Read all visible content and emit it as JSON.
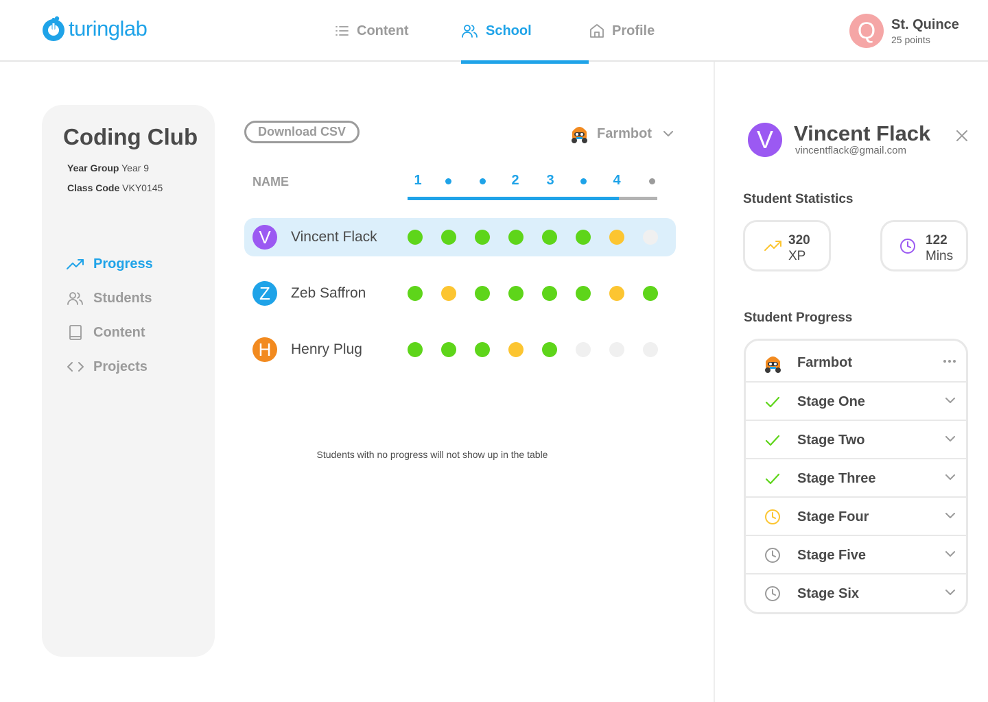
{
  "brand": {
    "name": "turinglab",
    "color": "#1fa3e8"
  },
  "nav": {
    "items": [
      {
        "label": "Content",
        "icon": "list-icon",
        "active": false
      },
      {
        "label": "School",
        "icon": "users-icon",
        "active": true
      },
      {
        "label": "Profile",
        "icon": "home-icon",
        "active": false
      }
    ]
  },
  "user": {
    "initial": "Q",
    "name": "St. Quince",
    "points": "25 points"
  },
  "class": {
    "title": "Coding Club",
    "year_group_label": "Year Group",
    "year_group_value": "Year 9",
    "class_code_label": "Class Code",
    "class_code_value": "VKY0145"
  },
  "sidebar": {
    "items": [
      {
        "label": "Progress",
        "icon": "trending-up-icon",
        "active": true
      },
      {
        "label": "Students",
        "icon": "users-icon",
        "active": false
      },
      {
        "label": "Content",
        "icon": "book-icon",
        "active": false
      },
      {
        "label": "Projects",
        "icon": "code-icon",
        "active": false
      }
    ]
  },
  "table": {
    "download_label": "Download CSV",
    "course": "Farmbot",
    "name_header": "NAME",
    "columns": [
      "1",
      "•",
      "•",
      "2",
      "3",
      "•",
      "4",
      "•"
    ],
    "progress_fraction": 0.846,
    "rows": [
      {
        "initial": "V",
        "name": "Vincent Flack",
        "color": "#9b59f2",
        "selected": true,
        "cells": [
          "done",
          "done",
          "done",
          "done",
          "done",
          "done",
          "partial",
          "empty"
        ]
      },
      {
        "initial": "Z",
        "name": "Zeb Saffron",
        "color": "#1fa3e8",
        "selected": false,
        "cells": [
          "done",
          "partial",
          "done",
          "done",
          "done",
          "done",
          "partial",
          "done"
        ]
      },
      {
        "initial": "H",
        "name": "Henry Plug",
        "color": "#f28a1f",
        "selected": false,
        "cells": [
          "done",
          "done",
          "done",
          "partial",
          "done",
          "empty",
          "empty",
          "empty"
        ]
      }
    ],
    "note": "Students with no progress will not show up in the table"
  },
  "student": {
    "initial": "V",
    "name": "Vincent Flack",
    "email": "vincentflack@gmail.com",
    "stats_heading": "Student Statistics",
    "stats": [
      {
        "value": "320",
        "unit": "XP",
        "icon": "trending-up-icon",
        "color": "#fcc531"
      },
      {
        "value": "122",
        "unit": "Mins",
        "icon": "clock-icon",
        "color": "#9b59f2"
      }
    ],
    "progress_heading": "Student Progress",
    "course": "Farmbot",
    "stages": [
      {
        "label": "Stage One",
        "status": "complete"
      },
      {
        "label": "Stage Two",
        "status": "complete"
      },
      {
        "label": "Stage Three",
        "status": "complete"
      },
      {
        "label": "Stage Four",
        "status": "in-progress"
      },
      {
        "label": "Stage Five",
        "status": "not-started"
      },
      {
        "label": "Stage Six",
        "status": "not-started"
      }
    ]
  },
  "colors": {
    "done": "#5ed51a",
    "partial": "#fcc531",
    "empty": "#f0f0f0",
    "accent": "#1fa3e8"
  }
}
